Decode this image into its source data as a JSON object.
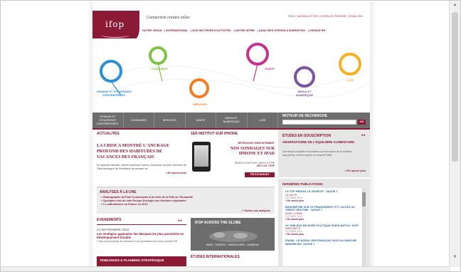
{
  "header": {
    "logo_text": "ifop",
    "tagline": "Connection creates value",
    "utility_links": "RSS  |  NEWSLETTER  |  ESPACE PRESSE  |  ENGLISH",
    "nav": [
      "NOTRE VISION",
      "INTERNATIONAL",
      "NOS SECTEURS D'ACTIVITÉS",
      "NOTRE OFFRE",
      "ANALYSES OPINION & MARKETING",
      "ESPACE RH"
    ]
  },
  "hero": {
    "labels": {
      "opinion": "OPINION ET STRATÉGIES D'ENTREPRISES",
      "consumer": "CONSUMER",
      "services": "SERVICES",
      "sante": "SANTÉ",
      "media": "MEDIA ET NUMERIQUE",
      "luxe": "LUXE"
    },
    "colors": {
      "opinion": "#2c8fd4",
      "consumer": "#7dc242",
      "services": "#f47b20",
      "sante": "#c4318f",
      "media": "#7d52a3",
      "luxe": "#f6b11f"
    }
  },
  "section_nav": [
    "OPINION ET STRATÉGIES D'ENTREPRISES",
    "CONSUMER",
    "SERVICES",
    "SANTÉ",
    "MEDIA ET NUMERIQUE",
    "LUXE"
  ],
  "search": {
    "title": "MOTEUR DE RECHERCHE",
    "button": "OK"
  },
  "actualites": {
    "heading": "ACTUALITÉS",
    "title": "LA CRISE A MONTRÉ L'ANCRAGE PROFOND DES HABITUDES DE VACANCES DES FRANÇAIS",
    "text": "En période estivale, Marie-Laurence Guéna, Directrice du pôle Services de l'Ifop témoigne de l'évolution du secteur du",
    "more": "» En savoir plus"
  },
  "iphone": {
    "heading": "1ER INSTITUT SUR IPHONE",
    "sub": "RETROUVEZ GRATUITEMENT",
    "title": "NOS SONDAGES SUR IPHONE ET IPAD",
    "note1": "RENDEZ-VOUS SUR L'APPLE STORE",
    "note2": "MOT CLÉ : IFOP",
    "button": "TÉLÉCHARGEZ"
  },
  "analyses": {
    "heading": "ANALYSES À LA UNE",
    "items": [
      "» Radiographie du Parti Communiste à la veille de la Fête de l'Humanité",
      "» Quelques clés du vote Europe Ecologie aux élections régionales",
      "» Le catholicisme en France en 2010"
    ],
    "all": "» Toutes nos analyses"
  },
  "events": {
    "heading": "EVENEMENTS",
    "date": "24 SEPTEMBRE 2010",
    "title": "Les stratégies gagnantes des Marques les plus pionnières en Développement Durable",
    "text": "L'Ifop vous propose de répondre à vos questions lors d'une journée DR"
  },
  "tendances": "TENDANCES & PLANNING STRATÉGIQUE",
  "globe": {
    "title": "IFOP ACROSS THE GLOBE",
    "cities": "PARIS - TORONTO - BUENOS AIRES - SHANGHAI"
  },
  "etudes_int": "ÉTUDES INTERNATIONALES",
  "souscription": {
    "heading": "ÉTUDES EN SOUSCRIPTION",
    "title": "OBSERVATOIRE DE L'EQUILIBRE ALIMENTAIRE",
    "text": "Une étude complète et exclusive sur les enjeux de la nutrition aujourd'hui, menée auprès du Grand Public.",
    "more": "» En savoir plus"
  },
  "publications": {
    "heading": "DERNIÈRES PUBLICATIONS",
    "items": [
      {
        "title": "LE TOP MEDIAS LE JDD/IFOP - VAGUE 1",
        "source": "LE JDD.FR",
        "date": "OCTOBRE 2010",
        "more": "» En savoir plus"
      },
      {
        "title": "BAROMÈTRE SUR LE FINANCEMENT ET L'ACCÈS AU CRÉDIT DES PME - VAGUE 7",
        "source": "KPMG / CGPME",
        "date": "OCTOBRE 2010",
        "more": "» En savoir plus"
      },
      {
        "title": "LE TABLEAU DE BORD POLITIQUE PARIS MATCH - IFOP",
        "source": "PARIS MATCH",
        "date": "OCTOBRE 2010",
        "more": "» En savoir plus"
      },
      {
        "title": "FNAIM : LE MORAL DES FRANÇAIS FACE AU MARCHÉ IMMOBILIER, VAGUE 1",
        "source": "",
        "date": "",
        "more": ""
      }
    ]
  }
}
